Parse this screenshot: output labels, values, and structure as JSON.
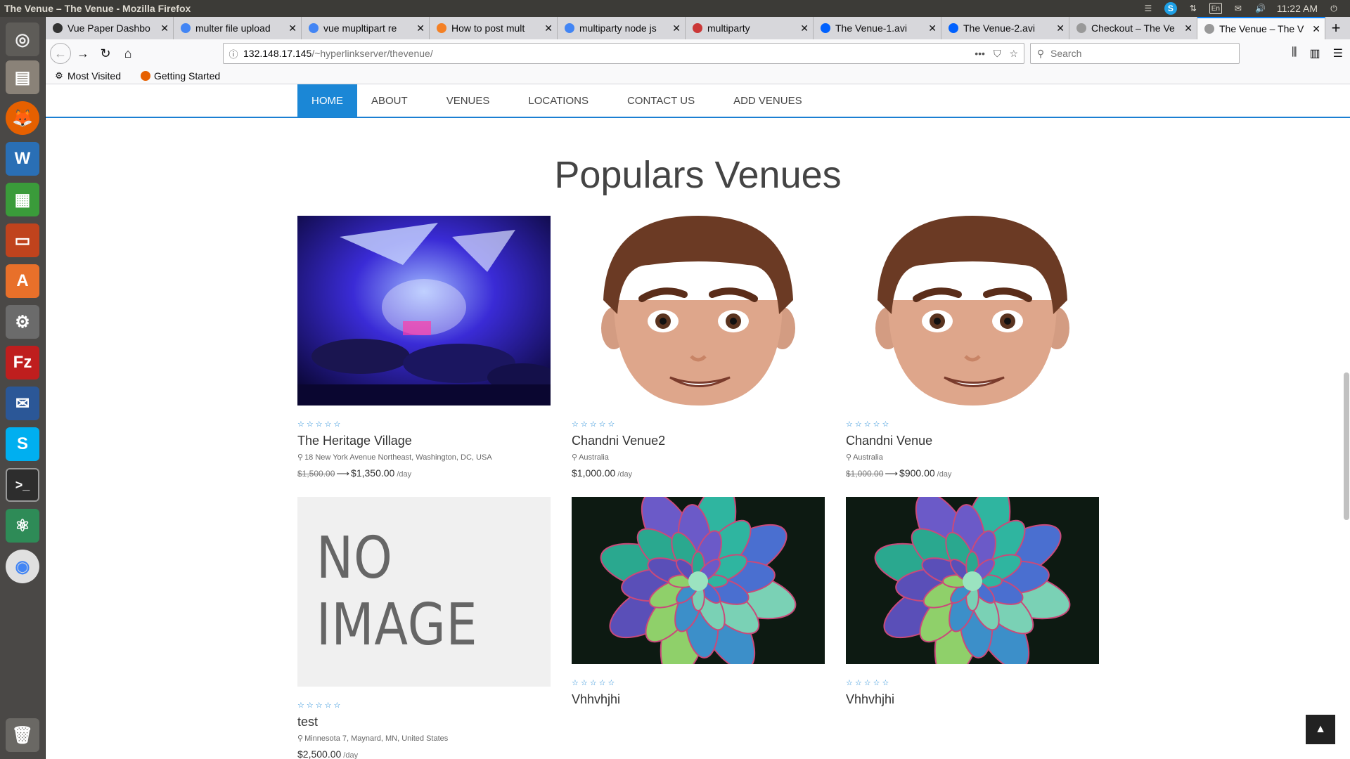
{
  "window": {
    "title": "The Venue – The Venue - Mozilla Firefox"
  },
  "panel": {
    "keyboard": "En",
    "clock": "11:22 AM"
  },
  "tabs": [
    {
      "label": "Vue Paper Dashbo",
      "favicon_color": "#333333"
    },
    {
      "label": "multer file upload",
      "favicon_color": "#4285f4"
    },
    {
      "label": "vue mupltipart re",
      "favicon_color": "#4285f4"
    },
    {
      "label": "How to post mult",
      "favicon_color": "#f48024"
    },
    {
      "label": "multiparty node js",
      "favicon_color": "#4285f4"
    },
    {
      "label": "multiparty",
      "favicon_color": "#cb3837"
    },
    {
      "label": "The Venue-1.avi",
      "favicon_color": "#0061fe"
    },
    {
      "label": "The Venue-2.avi",
      "favicon_color": "#0061fe"
    },
    {
      "label": "Checkout – The Ve",
      "favicon_color": "#999999"
    },
    {
      "label": "The Venue – The V",
      "favicon_color": "#999999"
    }
  ],
  "urlbar": {
    "host": "132.148.17.145",
    "path": "/~hyperlinkserver/thevenue/"
  },
  "search": {
    "placeholder": "Search"
  },
  "bookmarks": [
    {
      "label": "Most Visited",
      "icon": "gear-icon"
    },
    {
      "label": "Getting Started",
      "icon": "firefox-icon"
    }
  ],
  "site_menu": [
    {
      "label": "HOME",
      "active": true
    },
    {
      "label": "ABOUT"
    },
    {
      "label": "VENUES"
    },
    {
      "label": "LOCATIONS"
    },
    {
      "label": "CONTACT US"
    },
    {
      "label": "ADD VENUES"
    }
  ],
  "section": {
    "title": "Populars Venues"
  },
  "venues": [
    {
      "name": "The Heritage Village",
      "location": "18 New York Avenue Northeast, Washington, DC, USA",
      "old_price": "$1,500.00",
      "price": "$1,350.00",
      "unit": "/day",
      "image": "event-hall",
      "rating": 0
    },
    {
      "name": "Chandni Venue2",
      "location": "Australia",
      "old_price": "",
      "price": "$1,000.00",
      "unit": "/day",
      "image": "cartoon-face",
      "rating": 0
    },
    {
      "name": "Chandni Venue",
      "location": "Australia",
      "old_price": "$1,000.00",
      "price": "$900.00",
      "unit": "/day",
      "image": "cartoon-face",
      "rating": 0
    },
    {
      "name": "test",
      "location": "Minnesota 7, Maynard, MN, United States",
      "old_price": "",
      "price": "$2,500.00",
      "unit": "/day",
      "image": "no-image",
      "rating": 0,
      "image_text": "NO IMAGE"
    },
    {
      "name": "Vhhvhjhi",
      "location": "",
      "old_price": "",
      "price": "",
      "unit": "",
      "image": "succulent",
      "rating": 0
    },
    {
      "name": "Vhhvhjhi",
      "location": "",
      "old_price": "",
      "price": "",
      "unit": "",
      "image": "succulent",
      "rating": 0
    }
  ],
  "stars_text": "☆☆☆☆☆",
  "location_pin": "⚲",
  "price_arrow": "⟶"
}
